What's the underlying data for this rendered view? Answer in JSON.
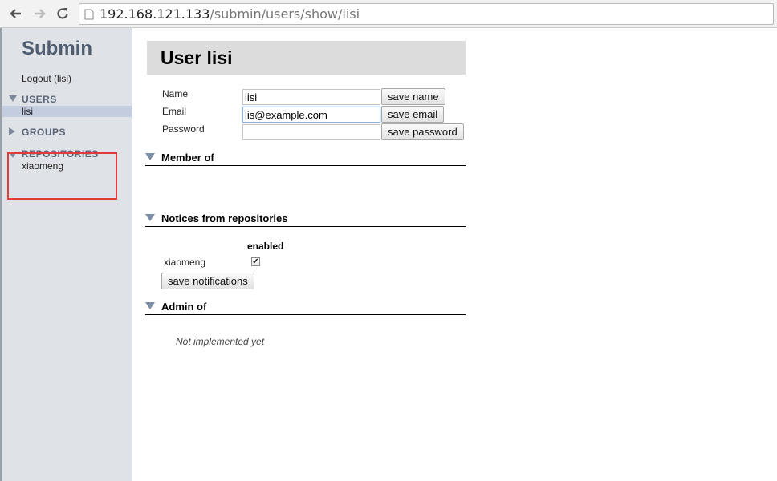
{
  "browser": {
    "url_host": "192.168.121.133",
    "url_path": "/submin/users/show/lisi"
  },
  "sidebar": {
    "brand": "Submin",
    "logout": "Logout (lisi)",
    "sections": {
      "users": {
        "title": "USERS",
        "items": [
          "lisi"
        ]
      },
      "groups": {
        "title": "GROUPS"
      },
      "repositories": {
        "title": "REPOSITORIES",
        "items": [
          "xiaomeng"
        ]
      }
    }
  },
  "main": {
    "title": "User lisi",
    "fields": {
      "name": {
        "label": "Name",
        "value": "lisi",
        "button": "save name"
      },
      "email": {
        "label": "Email",
        "value": "lis@example.com",
        "button": "save email"
      },
      "password": {
        "label": "Password",
        "value": "",
        "button": "save password"
      }
    },
    "member_of": {
      "title": "Member of"
    },
    "notices": {
      "title": "Notices from repositories",
      "column": "enabled",
      "rows": [
        {
          "repo": "xiaomeng",
          "enabled": true
        }
      ],
      "button": "save notifications"
    },
    "admin_of": {
      "title": "Admin of",
      "note": "Not implemented yet"
    }
  },
  "colors": {
    "sidebar_bg": "#dfe2e7",
    "brand": "#4f5d70",
    "selected_item": "#c4cde0",
    "highlight_box": "#e33a3a",
    "title_bar_bg": "#dcdcdc"
  }
}
